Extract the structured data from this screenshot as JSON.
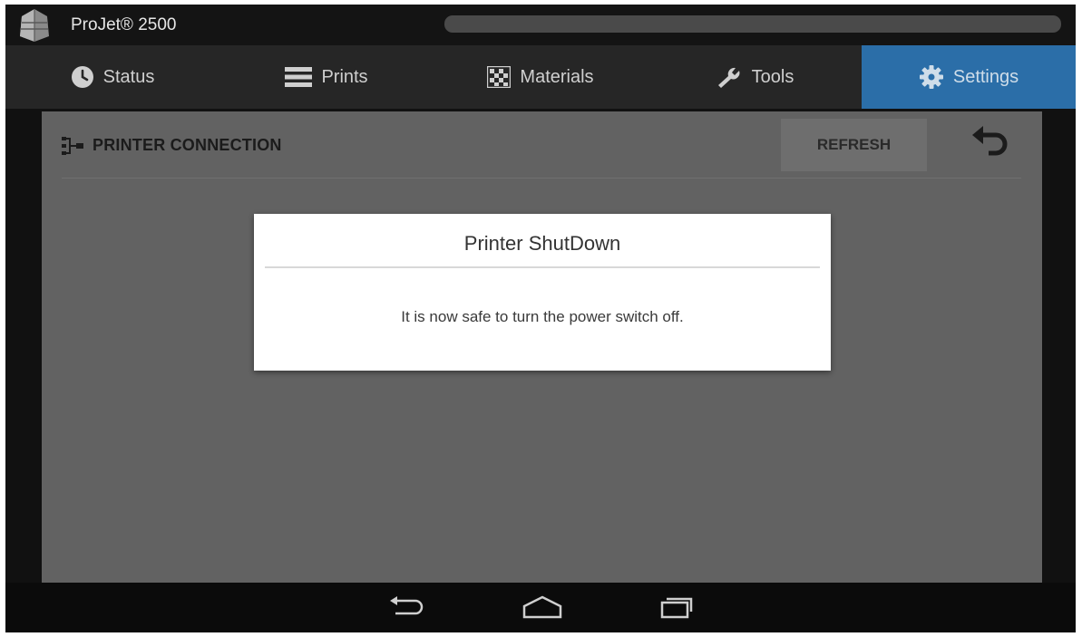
{
  "app": {
    "title": "ProJet® 2500",
    "progress_percent": 0
  },
  "tabs": [
    {
      "label": "Status",
      "icon": "clock-icon",
      "active": false
    },
    {
      "label": "Prints",
      "icon": "list-icon",
      "active": false
    },
    {
      "label": "Materials",
      "icon": "checker-icon",
      "active": false
    },
    {
      "label": "Tools",
      "icon": "wrench-icon",
      "active": false
    },
    {
      "label": "Settings",
      "icon": "gear-icon",
      "active": true
    }
  ],
  "panel": {
    "title": "PRINTER CONNECTION",
    "refresh_label": "REFRESH"
  },
  "dialog": {
    "title": "Printer ShutDown",
    "message": "It is now safe to turn the power switch off."
  },
  "colors": {
    "accent": "#2b6ea8",
    "panel": "#626262",
    "tabbar": "#262626"
  }
}
